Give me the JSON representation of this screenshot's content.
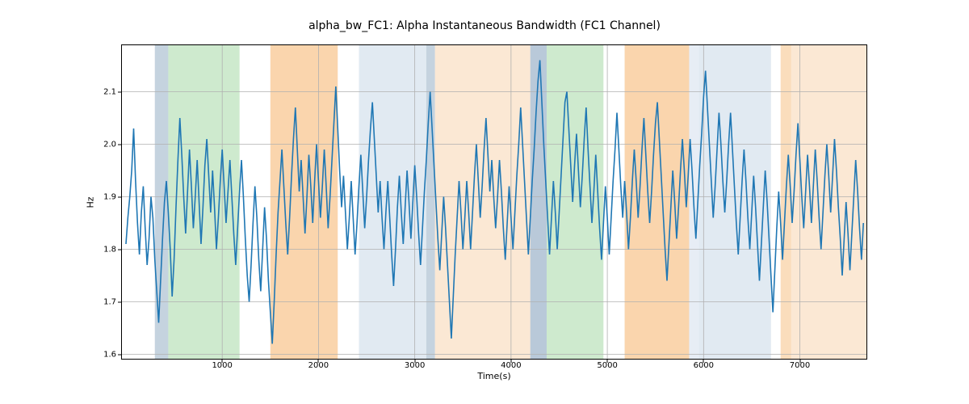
{
  "chart_data": {
    "type": "line",
    "title": "alpha_bw_FC1: Alpha Instantaneous Bandwidth (FC1 Channel)",
    "xlabel": "Time(s)",
    "ylabel": "Hz",
    "xlim": [
      -50,
      7700
    ],
    "ylim": [
      1.59,
      2.19
    ],
    "xticks": [
      1000,
      2000,
      3000,
      4000,
      5000,
      6000,
      7000
    ],
    "yticks": [
      1.6,
      1.7,
      1.8,
      1.9,
      2.0,
      2.1
    ],
    "line_color": "#1f77b4",
    "bands": [
      {
        "x0": 300,
        "x1": 440,
        "color": "#7f9db9",
        "alpha": 0.45
      },
      {
        "x0": 440,
        "x1": 1180,
        "color": "#a6d8a6",
        "alpha": 0.55
      },
      {
        "x0": 1500,
        "x1": 2200,
        "color": "#f5b36a",
        "alpha": 0.55
      },
      {
        "x0": 2420,
        "x1": 3120,
        "color": "#c9d8e8",
        "alpha": 0.55
      },
      {
        "x0": 3120,
        "x1": 3210,
        "color": "#7f9db9",
        "alpha": 0.45
      },
      {
        "x0": 3210,
        "x1": 4200,
        "color": "#f8d6b0",
        "alpha": 0.55
      },
      {
        "x0": 4200,
        "x1": 4370,
        "color": "#7f9db9",
        "alpha": 0.55
      },
      {
        "x0": 4370,
        "x1": 4960,
        "color": "#a6d8a6",
        "alpha": 0.55
      },
      {
        "x0": 5180,
        "x1": 5850,
        "color": "#f5b36a",
        "alpha": 0.55
      },
      {
        "x0": 5850,
        "x1": 5950,
        "color": "#c9d8e8",
        "alpha": 0.45
      },
      {
        "x0": 5950,
        "x1": 6700,
        "color": "#c9d8e8",
        "alpha": 0.55
      },
      {
        "x0": 6800,
        "x1": 6910,
        "color": "#f5b36a",
        "alpha": 0.45
      },
      {
        "x0": 6910,
        "x1": 7700,
        "color": "#f8d6b0",
        "alpha": 0.55
      }
    ],
    "x_start": 0,
    "x_step": 20,
    "values": [
      1.81,
      1.86,
      1.9,
      1.95,
      2.03,
      1.93,
      1.85,
      1.79,
      1.87,
      1.92,
      1.84,
      1.77,
      1.82,
      1.9,
      1.86,
      1.78,
      1.72,
      1.66,
      1.74,
      1.82,
      1.89,
      1.93,
      1.87,
      1.8,
      1.71,
      1.78,
      1.88,
      1.97,
      2.05,
      1.98,
      1.9,
      1.83,
      1.91,
      1.99,
      1.92,
      1.84,
      1.9,
      1.97,
      1.89,
      1.81,
      1.88,
      1.96,
      2.01,
      1.94,
      1.87,
      1.95,
      1.88,
      1.8,
      1.86,
      1.93,
      1.99,
      1.92,
      1.85,
      1.91,
      1.97,
      1.9,
      1.83,
      1.77,
      1.84,
      1.91,
      1.97,
      1.9,
      1.82,
      1.75,
      1.7,
      1.77,
      1.85,
      1.92,
      1.86,
      1.78,
      1.72,
      1.8,
      1.88,
      1.82,
      1.74,
      1.68,
      1.62,
      1.7,
      1.79,
      1.87,
      1.93,
      1.99,
      1.92,
      1.85,
      1.79,
      1.86,
      1.94,
      2.01,
      2.07,
      1.99,
      1.91,
      1.97,
      1.9,
      1.83,
      1.9,
      1.98,
      1.92,
      1.85,
      1.93,
      2.0,
      1.93,
      1.86,
      1.92,
      1.99,
      1.92,
      1.84,
      1.9,
      1.97,
      2.04,
      2.11,
      2.03,
      1.95,
      1.88,
      1.94,
      1.87,
      1.8,
      1.86,
      1.93,
      1.86,
      1.79,
      1.85,
      1.92,
      1.98,
      1.91,
      1.84,
      1.9,
      1.97,
      2.03,
      2.08,
      2.01,
      1.94,
      1.87,
      1.93,
      1.86,
      1.8,
      1.87,
      1.93,
      1.86,
      1.79,
      1.73,
      1.8,
      1.88,
      1.94,
      1.87,
      1.81,
      1.88,
      1.95,
      1.89,
      1.82,
      1.89,
      1.96,
      1.9,
      1.83,
      1.77,
      1.84,
      1.91,
      1.97,
      2.04,
      2.1,
      2.03,
      1.96,
      1.89,
      1.82,
      1.76,
      1.83,
      1.9,
      1.84,
      1.77,
      1.7,
      1.63,
      1.71,
      1.79,
      1.86,
      1.93,
      1.87,
      1.8,
      1.86,
      1.93,
      1.87,
      1.8,
      1.87,
      1.94,
      2.0,
      1.93,
      1.86,
      1.92,
      1.99,
      2.05,
      1.98,
      1.91,
      1.97,
      1.9,
      1.84,
      1.9,
      1.97,
      1.91,
      1.84,
      1.78,
      1.85,
      1.92,
      1.86,
      1.8,
      1.87,
      1.94,
      2.0,
      2.07,
      2.0,
      1.93,
      1.86,
      1.79,
      1.86,
      1.93,
      1.99,
      2.06,
      2.12,
      2.16,
      2.08,
      2.0,
      1.93,
      1.86,
      1.79,
      1.86,
      1.93,
      1.87,
      1.8,
      1.87,
      1.94,
      2.01,
      2.08,
      2.1,
      2.03,
      1.96,
      1.89,
      1.96,
      2.02,
      1.95,
      1.88,
      1.94,
      2.01,
      2.07,
      1.99,
      1.92,
      1.85,
      1.91,
      1.98,
      1.91,
      1.84,
      1.78,
      1.85,
      1.92,
      1.86,
      1.79,
      1.86,
      1.93,
      1.99,
      2.06,
      1.99,
      1.92,
      1.86,
      1.93,
      1.87,
      1.8,
      1.86,
      1.93,
      1.99,
      1.93,
      1.86,
      1.92,
      1.99,
      2.05,
      1.98,
      1.91,
      1.85,
      1.91,
      1.98,
      2.04,
      2.08,
      2.01,
      1.94,
      1.87,
      1.8,
      1.74,
      1.81,
      1.88,
      1.95,
      1.89,
      1.82,
      1.88,
      1.95,
      2.01,
      1.95,
      1.88,
      1.94,
      2.01,
      1.95,
      1.88,
      1.82,
      1.89,
      1.96,
      2.02,
      2.09,
      2.14,
      2.07,
      2.0,
      1.93,
      1.86,
      1.92,
      1.99,
      2.06,
      2.0,
      1.93,
      1.87,
      1.93,
      2.0,
      2.06,
      1.99,
      1.92,
      1.85,
      1.79,
      1.86,
      1.93,
      1.99,
      1.93,
      1.86,
      1.8,
      1.87,
      1.94,
      1.88,
      1.81,
      1.74,
      1.81,
      1.88,
      1.95,
      1.89,
      1.82,
      1.75,
      1.68,
      1.76,
      1.84,
      1.91,
      1.85,
      1.78,
      1.85,
      1.92,
      1.98,
      1.92,
      1.85,
      1.91,
      1.98,
      2.04,
      1.97,
      1.9,
      1.84,
      1.91,
      1.98,
      1.92,
      1.85,
      1.92,
      1.99,
      1.93,
      1.86,
      1.8,
      1.87,
      1.94,
      2.0,
      1.94,
      1.87,
      1.94,
      2.01,
      1.95,
      1.88,
      1.82,
      1.75,
      1.82,
      1.89,
      1.83,
      1.76,
      1.83,
      1.9,
      1.97,
      1.91,
      1.84,
      1.78,
      1.85
    ]
  }
}
